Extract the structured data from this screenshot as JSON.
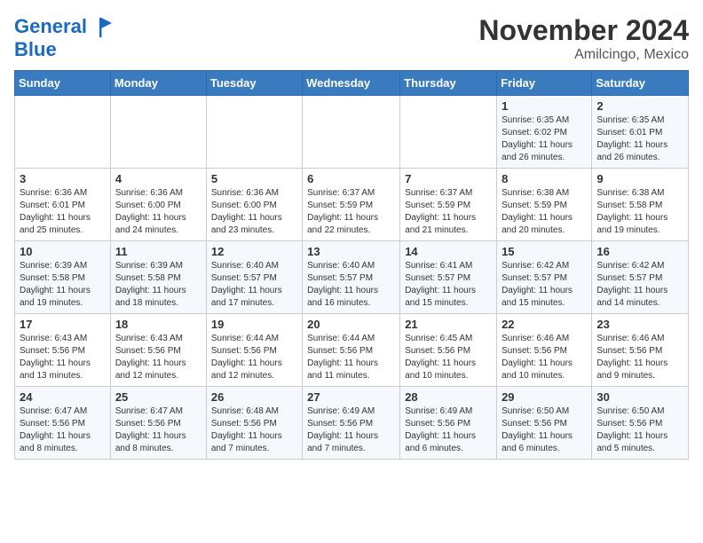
{
  "logo": {
    "line1": "General",
    "line2": "Blue"
  },
  "title": "November 2024",
  "location": "Amilcingo, Mexico",
  "days_of_week": [
    "Sunday",
    "Monday",
    "Tuesday",
    "Wednesday",
    "Thursday",
    "Friday",
    "Saturday"
  ],
  "weeks": [
    [
      {
        "day": "",
        "info": ""
      },
      {
        "day": "",
        "info": ""
      },
      {
        "day": "",
        "info": ""
      },
      {
        "day": "",
        "info": ""
      },
      {
        "day": "",
        "info": ""
      },
      {
        "day": "1",
        "info": "Sunrise: 6:35 AM\nSunset: 6:02 PM\nDaylight: 11 hours and 26 minutes."
      },
      {
        "day": "2",
        "info": "Sunrise: 6:35 AM\nSunset: 6:01 PM\nDaylight: 11 hours and 26 minutes."
      }
    ],
    [
      {
        "day": "3",
        "info": "Sunrise: 6:36 AM\nSunset: 6:01 PM\nDaylight: 11 hours and 25 minutes."
      },
      {
        "day": "4",
        "info": "Sunrise: 6:36 AM\nSunset: 6:00 PM\nDaylight: 11 hours and 24 minutes."
      },
      {
        "day": "5",
        "info": "Sunrise: 6:36 AM\nSunset: 6:00 PM\nDaylight: 11 hours and 23 minutes."
      },
      {
        "day": "6",
        "info": "Sunrise: 6:37 AM\nSunset: 5:59 PM\nDaylight: 11 hours and 22 minutes."
      },
      {
        "day": "7",
        "info": "Sunrise: 6:37 AM\nSunset: 5:59 PM\nDaylight: 11 hours and 21 minutes."
      },
      {
        "day": "8",
        "info": "Sunrise: 6:38 AM\nSunset: 5:59 PM\nDaylight: 11 hours and 20 minutes."
      },
      {
        "day": "9",
        "info": "Sunrise: 6:38 AM\nSunset: 5:58 PM\nDaylight: 11 hours and 19 minutes."
      }
    ],
    [
      {
        "day": "10",
        "info": "Sunrise: 6:39 AM\nSunset: 5:58 PM\nDaylight: 11 hours and 19 minutes."
      },
      {
        "day": "11",
        "info": "Sunrise: 6:39 AM\nSunset: 5:58 PM\nDaylight: 11 hours and 18 minutes."
      },
      {
        "day": "12",
        "info": "Sunrise: 6:40 AM\nSunset: 5:57 PM\nDaylight: 11 hours and 17 minutes."
      },
      {
        "day": "13",
        "info": "Sunrise: 6:40 AM\nSunset: 5:57 PM\nDaylight: 11 hours and 16 minutes."
      },
      {
        "day": "14",
        "info": "Sunrise: 6:41 AM\nSunset: 5:57 PM\nDaylight: 11 hours and 15 minutes."
      },
      {
        "day": "15",
        "info": "Sunrise: 6:42 AM\nSunset: 5:57 PM\nDaylight: 11 hours and 15 minutes."
      },
      {
        "day": "16",
        "info": "Sunrise: 6:42 AM\nSunset: 5:57 PM\nDaylight: 11 hours and 14 minutes."
      }
    ],
    [
      {
        "day": "17",
        "info": "Sunrise: 6:43 AM\nSunset: 5:56 PM\nDaylight: 11 hours and 13 minutes."
      },
      {
        "day": "18",
        "info": "Sunrise: 6:43 AM\nSunset: 5:56 PM\nDaylight: 11 hours and 12 minutes."
      },
      {
        "day": "19",
        "info": "Sunrise: 6:44 AM\nSunset: 5:56 PM\nDaylight: 11 hours and 12 minutes."
      },
      {
        "day": "20",
        "info": "Sunrise: 6:44 AM\nSunset: 5:56 PM\nDaylight: 11 hours and 11 minutes."
      },
      {
        "day": "21",
        "info": "Sunrise: 6:45 AM\nSunset: 5:56 PM\nDaylight: 11 hours and 10 minutes."
      },
      {
        "day": "22",
        "info": "Sunrise: 6:46 AM\nSunset: 5:56 PM\nDaylight: 11 hours and 10 minutes."
      },
      {
        "day": "23",
        "info": "Sunrise: 6:46 AM\nSunset: 5:56 PM\nDaylight: 11 hours and 9 minutes."
      }
    ],
    [
      {
        "day": "24",
        "info": "Sunrise: 6:47 AM\nSunset: 5:56 PM\nDaylight: 11 hours and 8 minutes."
      },
      {
        "day": "25",
        "info": "Sunrise: 6:47 AM\nSunset: 5:56 PM\nDaylight: 11 hours and 8 minutes."
      },
      {
        "day": "26",
        "info": "Sunrise: 6:48 AM\nSunset: 5:56 PM\nDaylight: 11 hours and 7 minutes."
      },
      {
        "day": "27",
        "info": "Sunrise: 6:49 AM\nSunset: 5:56 PM\nDaylight: 11 hours and 7 minutes."
      },
      {
        "day": "28",
        "info": "Sunrise: 6:49 AM\nSunset: 5:56 PM\nDaylight: 11 hours and 6 minutes."
      },
      {
        "day": "29",
        "info": "Sunrise: 6:50 AM\nSunset: 5:56 PM\nDaylight: 11 hours and 6 minutes."
      },
      {
        "day": "30",
        "info": "Sunrise: 6:50 AM\nSunset: 5:56 PM\nDaylight: 11 hours and 5 minutes."
      }
    ]
  ]
}
